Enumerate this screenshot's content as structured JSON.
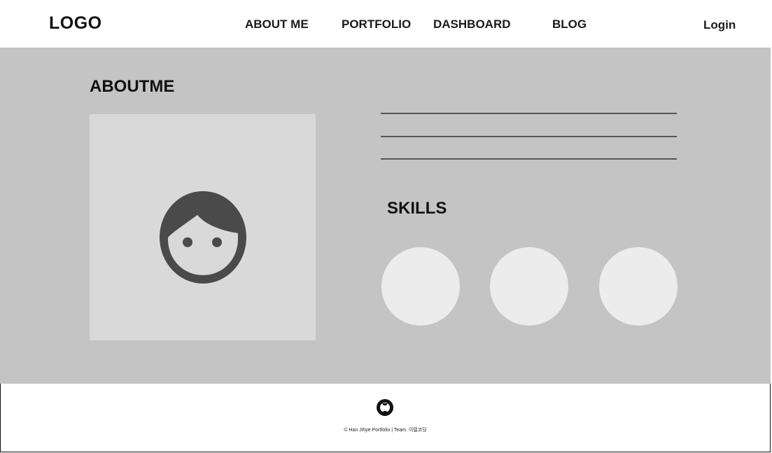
{
  "header": {
    "logo": "LOGO",
    "nav": [
      "ABOUT ME",
      "PORTFOLIO",
      "DASHBOARD",
      "BLOG"
    ],
    "login": "Login"
  },
  "about": {
    "title": "ABOUTME",
    "avatar_icon": "face-icon"
  },
  "skills": {
    "title": "SKILLS",
    "items": [
      "skill-circle",
      "skill-circle",
      "skill-circle"
    ]
  },
  "footer": {
    "icon": "github-icon",
    "copyright": "© Han Jihye Portfolio | Team. 이럴코딩"
  },
  "colors": {
    "header_bg": "#ffffff",
    "main_bg": "#c4c4c4",
    "photo_bg": "#d9d9d9",
    "skill_circle": "#ececec",
    "icon": "#4a4a4a"
  }
}
